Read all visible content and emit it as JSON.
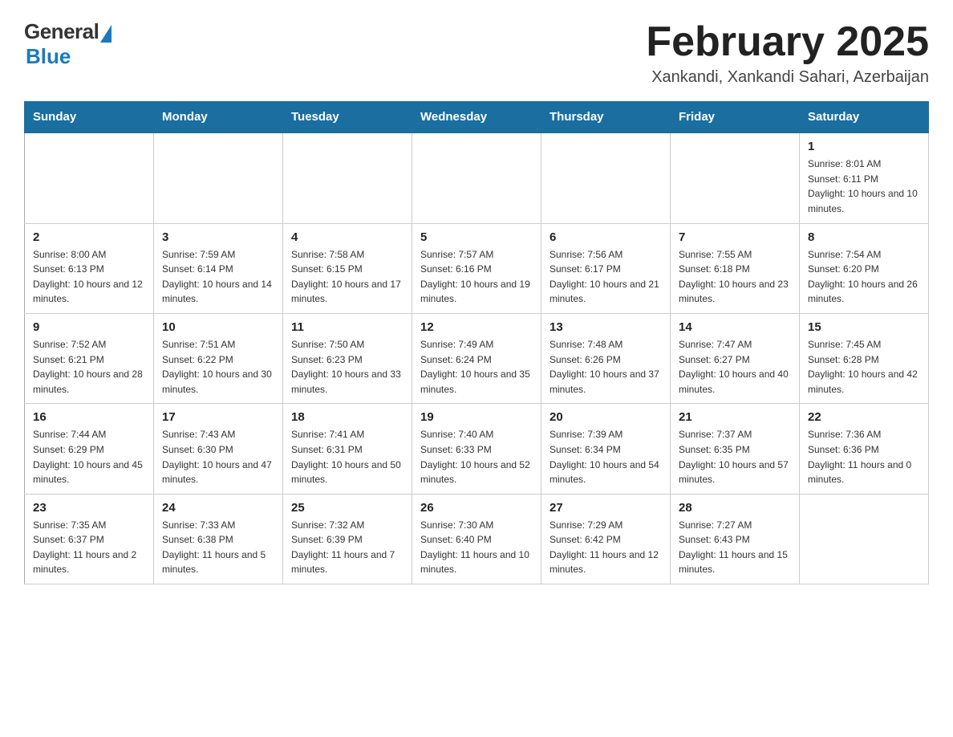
{
  "logo": {
    "general": "General",
    "blue": "Blue"
  },
  "title": "February 2025",
  "location": "Xankandi, Xankandi Sahari, Azerbaijan",
  "days_of_week": [
    "Sunday",
    "Monday",
    "Tuesday",
    "Wednesday",
    "Thursday",
    "Friday",
    "Saturday"
  ],
  "weeks": [
    [
      {
        "day": "",
        "sunrise": "",
        "sunset": "",
        "daylight": ""
      },
      {
        "day": "",
        "sunrise": "",
        "sunset": "",
        "daylight": ""
      },
      {
        "day": "",
        "sunrise": "",
        "sunset": "",
        "daylight": ""
      },
      {
        "day": "",
        "sunrise": "",
        "sunset": "",
        "daylight": ""
      },
      {
        "day": "",
        "sunrise": "",
        "sunset": "",
        "daylight": ""
      },
      {
        "day": "",
        "sunrise": "",
        "sunset": "",
        "daylight": ""
      },
      {
        "day": "1",
        "sunrise": "Sunrise: 8:01 AM",
        "sunset": "Sunset: 6:11 PM",
        "daylight": "Daylight: 10 hours and 10 minutes."
      }
    ],
    [
      {
        "day": "2",
        "sunrise": "Sunrise: 8:00 AM",
        "sunset": "Sunset: 6:13 PM",
        "daylight": "Daylight: 10 hours and 12 minutes."
      },
      {
        "day": "3",
        "sunrise": "Sunrise: 7:59 AM",
        "sunset": "Sunset: 6:14 PM",
        "daylight": "Daylight: 10 hours and 14 minutes."
      },
      {
        "day": "4",
        "sunrise": "Sunrise: 7:58 AM",
        "sunset": "Sunset: 6:15 PM",
        "daylight": "Daylight: 10 hours and 17 minutes."
      },
      {
        "day": "5",
        "sunrise": "Sunrise: 7:57 AM",
        "sunset": "Sunset: 6:16 PM",
        "daylight": "Daylight: 10 hours and 19 minutes."
      },
      {
        "day": "6",
        "sunrise": "Sunrise: 7:56 AM",
        "sunset": "Sunset: 6:17 PM",
        "daylight": "Daylight: 10 hours and 21 minutes."
      },
      {
        "day": "7",
        "sunrise": "Sunrise: 7:55 AM",
        "sunset": "Sunset: 6:18 PM",
        "daylight": "Daylight: 10 hours and 23 minutes."
      },
      {
        "day": "8",
        "sunrise": "Sunrise: 7:54 AM",
        "sunset": "Sunset: 6:20 PM",
        "daylight": "Daylight: 10 hours and 26 minutes."
      }
    ],
    [
      {
        "day": "9",
        "sunrise": "Sunrise: 7:52 AM",
        "sunset": "Sunset: 6:21 PM",
        "daylight": "Daylight: 10 hours and 28 minutes."
      },
      {
        "day": "10",
        "sunrise": "Sunrise: 7:51 AM",
        "sunset": "Sunset: 6:22 PM",
        "daylight": "Daylight: 10 hours and 30 minutes."
      },
      {
        "day": "11",
        "sunrise": "Sunrise: 7:50 AM",
        "sunset": "Sunset: 6:23 PM",
        "daylight": "Daylight: 10 hours and 33 minutes."
      },
      {
        "day": "12",
        "sunrise": "Sunrise: 7:49 AM",
        "sunset": "Sunset: 6:24 PM",
        "daylight": "Daylight: 10 hours and 35 minutes."
      },
      {
        "day": "13",
        "sunrise": "Sunrise: 7:48 AM",
        "sunset": "Sunset: 6:26 PM",
        "daylight": "Daylight: 10 hours and 37 minutes."
      },
      {
        "day": "14",
        "sunrise": "Sunrise: 7:47 AM",
        "sunset": "Sunset: 6:27 PM",
        "daylight": "Daylight: 10 hours and 40 minutes."
      },
      {
        "day": "15",
        "sunrise": "Sunrise: 7:45 AM",
        "sunset": "Sunset: 6:28 PM",
        "daylight": "Daylight: 10 hours and 42 minutes."
      }
    ],
    [
      {
        "day": "16",
        "sunrise": "Sunrise: 7:44 AM",
        "sunset": "Sunset: 6:29 PM",
        "daylight": "Daylight: 10 hours and 45 minutes."
      },
      {
        "day": "17",
        "sunrise": "Sunrise: 7:43 AM",
        "sunset": "Sunset: 6:30 PM",
        "daylight": "Daylight: 10 hours and 47 minutes."
      },
      {
        "day": "18",
        "sunrise": "Sunrise: 7:41 AM",
        "sunset": "Sunset: 6:31 PM",
        "daylight": "Daylight: 10 hours and 50 minutes."
      },
      {
        "day": "19",
        "sunrise": "Sunrise: 7:40 AM",
        "sunset": "Sunset: 6:33 PM",
        "daylight": "Daylight: 10 hours and 52 minutes."
      },
      {
        "day": "20",
        "sunrise": "Sunrise: 7:39 AM",
        "sunset": "Sunset: 6:34 PM",
        "daylight": "Daylight: 10 hours and 54 minutes."
      },
      {
        "day": "21",
        "sunrise": "Sunrise: 7:37 AM",
        "sunset": "Sunset: 6:35 PM",
        "daylight": "Daylight: 10 hours and 57 minutes."
      },
      {
        "day": "22",
        "sunrise": "Sunrise: 7:36 AM",
        "sunset": "Sunset: 6:36 PM",
        "daylight": "Daylight: 11 hours and 0 minutes."
      }
    ],
    [
      {
        "day": "23",
        "sunrise": "Sunrise: 7:35 AM",
        "sunset": "Sunset: 6:37 PM",
        "daylight": "Daylight: 11 hours and 2 minutes."
      },
      {
        "day": "24",
        "sunrise": "Sunrise: 7:33 AM",
        "sunset": "Sunset: 6:38 PM",
        "daylight": "Daylight: 11 hours and 5 minutes."
      },
      {
        "day": "25",
        "sunrise": "Sunrise: 7:32 AM",
        "sunset": "Sunset: 6:39 PM",
        "daylight": "Daylight: 11 hours and 7 minutes."
      },
      {
        "day": "26",
        "sunrise": "Sunrise: 7:30 AM",
        "sunset": "Sunset: 6:40 PM",
        "daylight": "Daylight: 11 hours and 10 minutes."
      },
      {
        "day": "27",
        "sunrise": "Sunrise: 7:29 AM",
        "sunset": "Sunset: 6:42 PM",
        "daylight": "Daylight: 11 hours and 12 minutes."
      },
      {
        "day": "28",
        "sunrise": "Sunrise: 7:27 AM",
        "sunset": "Sunset: 6:43 PM",
        "daylight": "Daylight: 11 hours and 15 minutes."
      },
      {
        "day": "",
        "sunrise": "",
        "sunset": "",
        "daylight": ""
      }
    ]
  ]
}
